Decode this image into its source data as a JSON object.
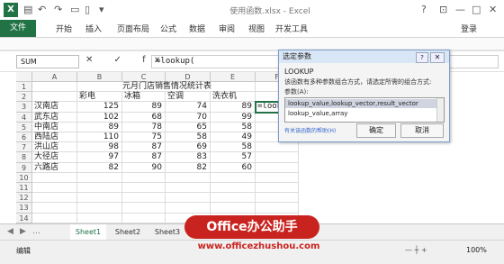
{
  "titlebar": {
    "title": "使用函数.xlsx - Excel",
    "help": "?",
    "controls": [
      "—",
      "□",
      "✕"
    ]
  },
  "ribbon": {
    "file": "文件",
    "tabs": [
      "开始",
      "插入",
      "页面布局",
      "公式",
      "数据",
      "审阅",
      "视图",
      "开发工具"
    ],
    "account": "登录"
  },
  "formula_bar": {
    "name_box": "SUM",
    "buttons": "✕ ✓ fx",
    "formula": "=lookup("
  },
  "columns": [
    "A",
    "B",
    "C",
    "D",
    "E",
    "F"
  ],
  "rows": [
    "1",
    "2",
    "3",
    "4",
    "5",
    "6",
    "7",
    "8",
    "9",
    "10",
    "11",
    "12",
    "13",
    "14",
    "15"
  ],
  "sheet": {
    "title": "元月门店销售情况统计表",
    "headers": [
      "彩电",
      "冰箱",
      "空调",
      "洗衣机"
    ],
    "stores": [
      {
        "name": "汉南店",
        "vals": [
          125,
          89,
          74,
          89
        ]
      },
      {
        "name": "武东店",
        "vals": [
          102,
          68,
          70,
          99
        ]
      },
      {
        "name": "中南店",
        "vals": [
          89,
          78,
          65,
          58
        ]
      },
      {
        "name": "西陆店",
        "vals": [
          110,
          75,
          58,
          49
        ]
      },
      {
        "name": "洪山店",
        "vals": [
          98,
          87,
          69,
          58
        ]
      },
      {
        "name": "大径店",
        "vals": [
          97,
          87,
          83,
          57
        ]
      },
      {
        "name": "六路店",
        "vals": [
          82,
          90,
          82,
          60
        ]
      }
    ],
    "active_cell": "=lookup("
  },
  "dialog": {
    "title": "选定参数",
    "function": "LOOKUP",
    "desc": "该函数有多种参数组合方式，请选定所需的组合方式:",
    "label": "参数(A):",
    "options": [
      "lookup_value,lookup_vector,result_vector",
      "lookup_value,array"
    ],
    "link": "有关该函数的帮助(H)",
    "ok": "确定",
    "cancel": "取消"
  },
  "tabs": {
    "sheets": [
      "Sheet1",
      "Sheet2",
      "Sheet3"
    ]
  },
  "status": {
    "mode": "编辑",
    "zoom": "100%"
  },
  "watermark": {
    "logo": "Office办公助手",
    "url": "www.officezhushou.com"
  }
}
